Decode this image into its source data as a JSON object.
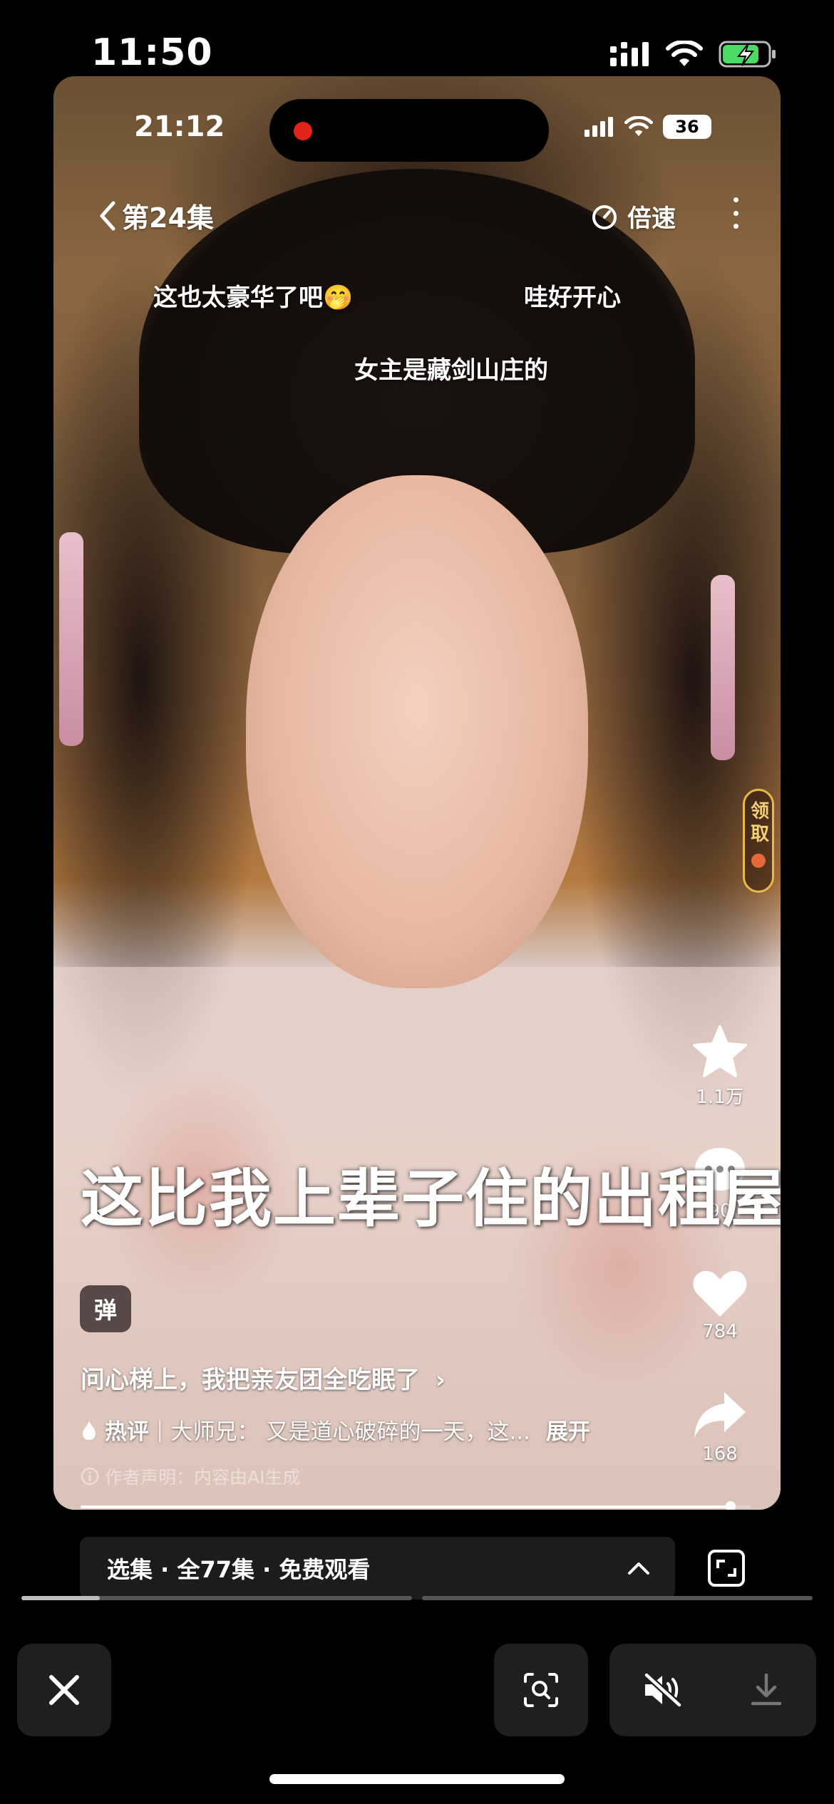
{
  "outer_status": {
    "time": "11:50"
  },
  "player": {
    "inner_status": {
      "time": "21:12",
      "battery": "36"
    },
    "header": {
      "episode": "第24集",
      "speed_label": "倍速"
    },
    "danmaku": [
      {
        "text": "这也太豪华了吧🤭"
      },
      {
        "text": "哇好开心"
      },
      {
        "text": "女主是藏剑山庄的"
      }
    ],
    "claim_badge": "领取",
    "actions": {
      "favorite_count": "1.1万",
      "comment_count": "90",
      "like_count": "784",
      "share_count": "168"
    },
    "subtitle": "这比我上辈子住的出租屋",
    "danmaku_toggle": "弹",
    "series_title": "问心梯上，我把亲友团全吃眠了",
    "hot_comment": {
      "tag": "热评",
      "author": "大师兄：",
      "text": "又是道心破碎的一天，这...",
      "expand": "展开"
    },
    "notice": "作者声明：内容由AI生成",
    "progress": 0.97
  },
  "episode_bar": {
    "label": "选集 · 全77集 · 免费观看"
  },
  "scrubber": {
    "progress": 0.2
  },
  "colors": {
    "accent_gold": "#e8b948",
    "recording_red": "#e2231a",
    "battery_green": "#4cd964"
  }
}
